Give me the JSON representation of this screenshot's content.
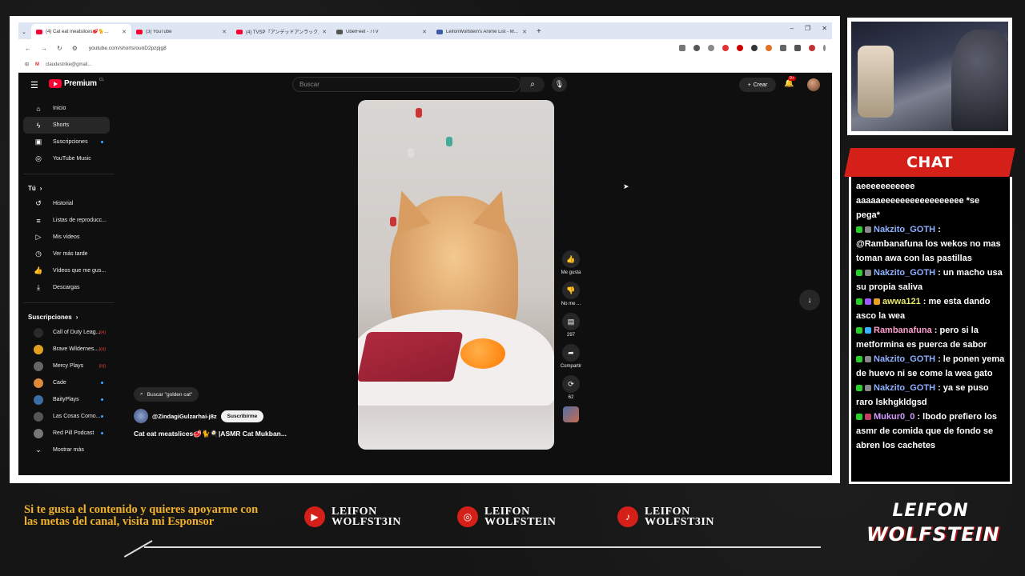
{
  "browser": {
    "tabs": [
      {
        "title": "(4) Cat eat meatslices🥩🐈...",
        "active": true,
        "fav": "yt"
      },
      {
        "title": "(3) YouTube",
        "active": false,
        "fav": "yt"
      },
      {
        "title": "(4) TVSP『アンデッドアンラック』[W...",
        "active": false,
        "fav": "yt"
      },
      {
        "title": "ÜbelFeet - 7TV",
        "active": false,
        "fav": "g"
      },
      {
        "title": "LeifonWolfstein's Anime List - M...",
        "active": false,
        "fav": "b"
      }
    ],
    "url": "youtube.com/shorts/ounD2pzpjg8",
    "bookmark": "claudestrike@gmail..."
  },
  "youtube": {
    "logo_text": "Premium",
    "logo_sup": "CL",
    "search_placeholder": "Buscar",
    "create_label": "Crear",
    "notif_count": "9+",
    "nav": [
      {
        "label": "Inicio",
        "icon": "home-icon",
        "glyph": "⌂",
        "active": false
      },
      {
        "label": "Shorts",
        "icon": "shorts-icon",
        "glyph": "ϟ",
        "active": true
      },
      {
        "label": "Suscripciones",
        "icon": "subscriptions-icon",
        "glyph": "▣",
        "active": false,
        "dot": true
      },
      {
        "label": "YouTube Music",
        "icon": "music-icon",
        "glyph": "◎",
        "active": false
      }
    ],
    "you_title": "Tú",
    "you_items": [
      {
        "label": "Historial",
        "icon": "history-icon",
        "glyph": "↺"
      },
      {
        "label": "Listas de reproducc...",
        "icon": "playlist-icon",
        "glyph": "≡"
      },
      {
        "label": "Mis vídeos",
        "icon": "my-videos-icon",
        "glyph": "▷"
      },
      {
        "label": "Ver más tarde",
        "icon": "watch-later-icon",
        "glyph": "◷"
      },
      {
        "label": "Vídeos que me gus...",
        "icon": "liked-icon",
        "glyph": "👍"
      },
      {
        "label": "Descargas",
        "icon": "download-icon",
        "glyph": "⤓"
      }
    ],
    "subs_title": "Suscripciones",
    "subs": [
      {
        "label": "Call of Duty Leag...",
        "color": "#2a2a2a",
        "badge": "live"
      },
      {
        "label": "Brave Wildernes...",
        "color": "#e0a020",
        "badge": "live"
      },
      {
        "label": "Mercy Plays",
        "color": "#666",
        "badge": "live"
      },
      {
        "label": "Cade",
        "color": "#e08a3c",
        "badge": "dot"
      },
      {
        "label": "BaityPlays",
        "color": "#3a6ea5",
        "badge": "dot"
      },
      {
        "label": "Las Cosas Como...",
        "color": "#555",
        "badge": "dot"
      },
      {
        "label": "Red Pill Podcast",
        "color": "#777",
        "badge": "dot"
      }
    ],
    "show_more": "Mostrar más",
    "short": {
      "search_chip": "Buscar \"golden cat\"",
      "channel": "@ZindagiGulzarhai-j8z",
      "subscribe": "Suscribirme",
      "title": "Cat eat meatslices🥩🐈🍳|ASMR Cat Mukban..."
    },
    "actions": [
      {
        "label": "Me gusta",
        "icon": "like-icon",
        "glyph": "👍"
      },
      {
        "label": "No me ...",
        "icon": "dislike-icon",
        "glyph": "👎"
      },
      {
        "label": "297",
        "icon": "comment-icon",
        "glyph": "▤"
      },
      {
        "label": "Compartir",
        "icon": "share-icon",
        "glyph": "➦"
      },
      {
        "label": "62",
        "icon": "remix-icon",
        "glyph": "⟳"
      }
    ]
  },
  "chat": {
    "title": "CHAT",
    "messages": [
      {
        "user": "",
        "color": "#fff",
        "badges": [],
        "text": "aeeeeeeeeeee aaaaaeeeeeeeeeeeeeeeee *se pega*"
      },
      {
        "user": "Nakzito_GOTH",
        "color": "#8fb0ff",
        "badges": [
          "#27d12a",
          "#888"
        ],
        "text": "@Rambanafuna los wekos no mas toman awa con las pastillas"
      },
      {
        "user": "Nakzito_GOTH",
        "color": "#8fb0ff",
        "badges": [
          "#27d12a",
          "#888"
        ],
        "text": "un macho usa su propia saliva"
      },
      {
        "user": "awwa121",
        "color": "#e8e86a",
        "badges": [
          "#27d12a",
          "#9a5cff",
          "#e8a020"
        ],
        "text": "me esta dando asco la wea"
      },
      {
        "user": "Rambanafuna",
        "color": "#ff9ecf",
        "badges": [
          "#27d12a",
          "#3ab0ff"
        ],
        "text": "pero si la metformina es puerca de sabor"
      },
      {
        "user": "Nakzito_GOTH",
        "color": "#8fb0ff",
        "badges": [
          "#27d12a",
          "#888"
        ],
        "text": "le ponen yema de huevo ni se come la wea gato"
      },
      {
        "user": "Nakzito_GOTH",
        "color": "#8fb0ff",
        "badges": [
          "#27d12a",
          "#888"
        ],
        "text": "ya se puso raro lskhgkldgsd"
      },
      {
        "user": "Mukur0_0",
        "color": "#d49bff",
        "badges": [
          "#27d12a",
          "#c04060"
        ],
        "text": "lbodo prefiero los asmr de comida que de fondo se abren los cachetes"
      }
    ]
  },
  "overlay": {
    "promo": "Si te gusta el contenido y quieres apoyarme con las metas del canal, visita mi Esponsor",
    "socials": [
      {
        "icon": "youtube-icon",
        "glyph": "▶",
        "line1": "LEIFON",
        "line2": "WOLFST3IN"
      },
      {
        "icon": "instagram-icon",
        "glyph": "◎",
        "line1": "LEIFON",
        "line2": "WOLFSTEIN"
      },
      {
        "icon": "tiktok-icon",
        "glyph": "♪",
        "line1": "LEIFON",
        "line2": "WOLFST3IN"
      }
    ],
    "brand_line1": "LEIFON",
    "brand_line2": "WOLFSTEIN"
  }
}
